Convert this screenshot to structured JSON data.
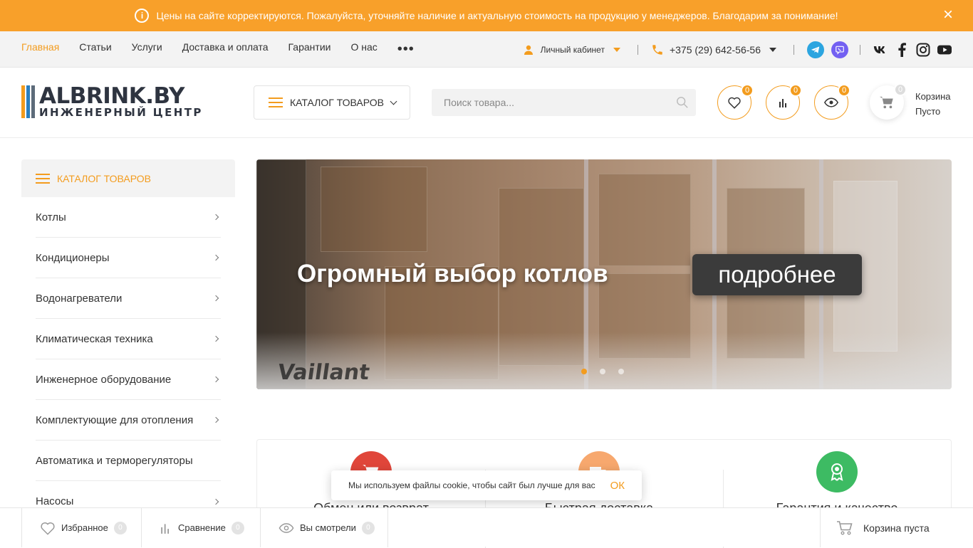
{
  "notice": {
    "text": "Цены на сайте корректируются. Пожалуйста, уточняйте наличие и актуальную стоимость на продукцию у менеджеров. Благодарим за понимание!",
    "close_icon": "×"
  },
  "topnav": {
    "items": [
      "Главная",
      "Статьи",
      "Услуги",
      "Доставка и оплата",
      "Гарантии",
      "О нас"
    ],
    "more": "•••",
    "cabinet": "Личный кабинет",
    "phone": "+375 (29) 642-56-56"
  },
  "header": {
    "logo_main": "ALBRINK.BY",
    "logo_sub": "ИНЖЕНЕРНЫЙ ЦЕНТР",
    "catalog_button": "КАТАЛОГ ТОВАРОВ",
    "search_placeholder": "Поиск товара...",
    "favorites_count": "0",
    "compare_count": "0",
    "viewed_count": "0",
    "cart_count": "0",
    "cart_label": "Корзина",
    "cart_status": "Пусто"
  },
  "sidebar": {
    "title": "КАТАЛОГ ТОВАРОВ",
    "items": [
      {
        "label": "Котлы",
        "arrow": true
      },
      {
        "label": "Кондиционеры",
        "arrow": true
      },
      {
        "label": "Водонагреватели",
        "arrow": true
      },
      {
        "label": "Климатическая техника",
        "arrow": true
      },
      {
        "label": "Инженерное оборудование",
        "arrow": true
      },
      {
        "label": "Комплектующие для отопления",
        "arrow": true
      },
      {
        "label": "Автоматика и терморегуляторы",
        "arrow": false
      },
      {
        "label": "Насосы",
        "arrow": true
      }
    ]
  },
  "banner": {
    "title": "Огромный выбор котлов",
    "button": "подробнее",
    "brand_on_box": "Vaillant",
    "active_slide": 1,
    "slides": 3
  },
  "features": [
    {
      "title": "Обмен или возврат",
      "color": "#e0463a"
    },
    {
      "title": "Быстрая доставка",
      "color": "#f7a86e"
    },
    {
      "title": "Гарантия и качество",
      "color": "#3dbb63"
    }
  ],
  "cookie": {
    "text": "Мы используем файлы cookie, чтобы сайт был лучше для вас",
    "ok": "ОК"
  },
  "bottombar": {
    "favorites": "Избранное",
    "favorites_count": "0",
    "compare": "Сравнение",
    "compare_count": "0",
    "viewed": "Вы смотрели",
    "viewed_count": "0",
    "cart": "Корзина пуста"
  },
  "colors": {
    "accent": "#f39c1e",
    "notice_bg": "#f8a02a"
  }
}
